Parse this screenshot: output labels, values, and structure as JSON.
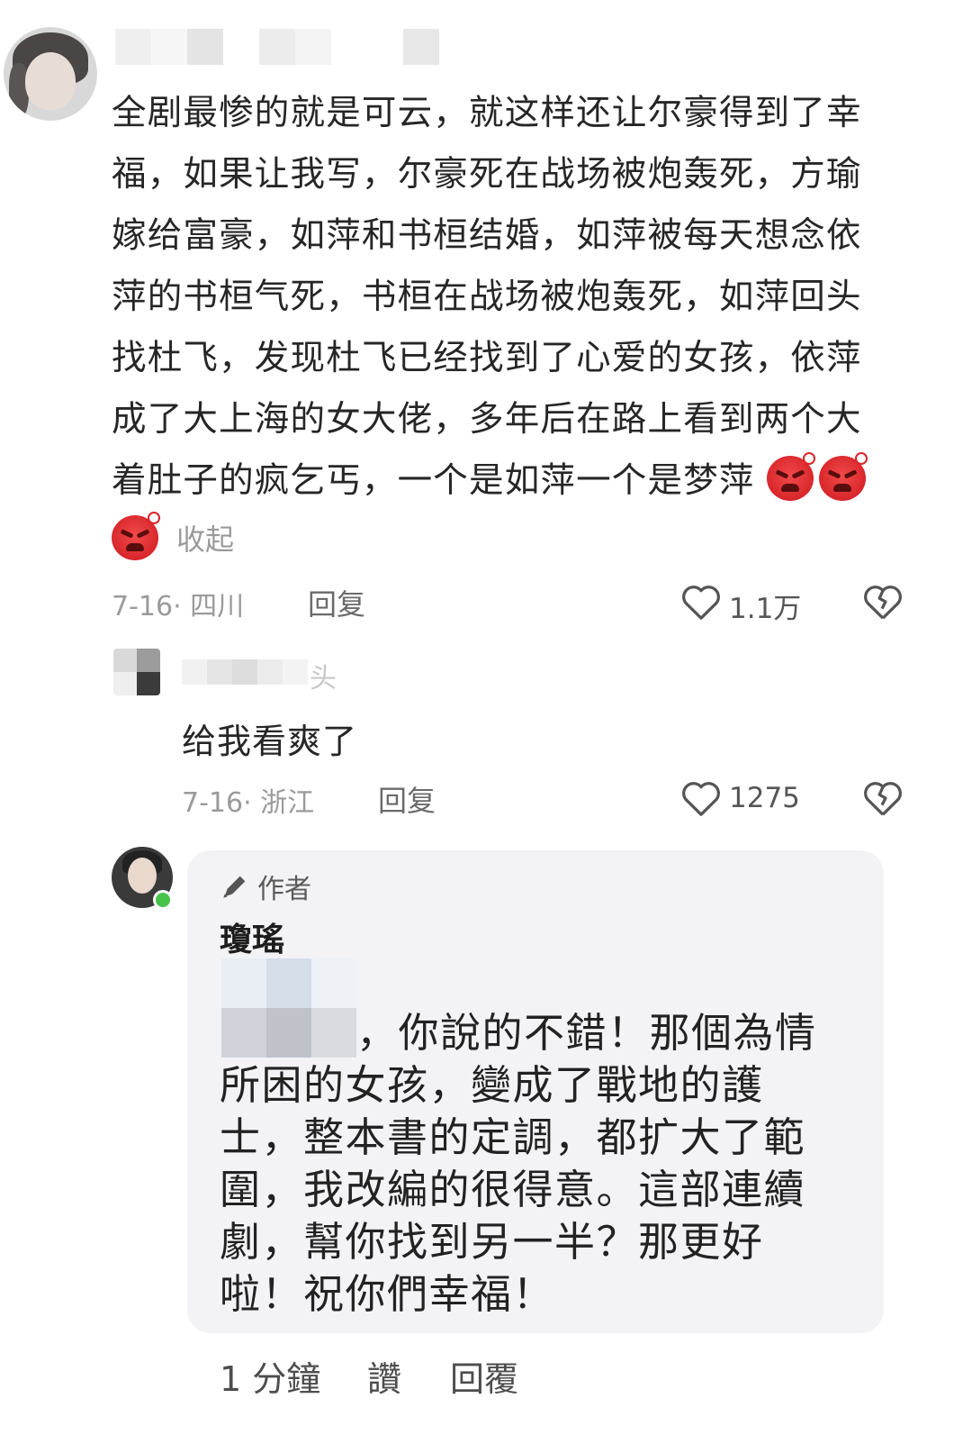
{
  "main_comment": {
    "text_lines": [
      "全剧最惨的就是可云，就这样还让尔豪得到了幸",
      "福，如果让我写，尔豪死在战场被炮轰死，方瑜",
      "嫁给富豪，如萍和书桓结婚，如萍被每天想念依",
      "萍的书桓气死，书桓在战场被炮轰死，如萍回头",
      "找杜飞，发现杜飞已经找到了心爱的女孩，依萍",
      "成了大上海的女大佬，多年后在路上看到两个大",
      "着肚子的疯乞丐，一个是如萍一个是梦萍"
    ],
    "emoji_name": "angry-face-emoji",
    "collapse_label": "收起",
    "date": "7-16",
    "location": "四川",
    "reply_label": "回复",
    "like_count": "1.1万"
  },
  "sub_reply": {
    "username_suffix": "头",
    "text": "给我看爽了",
    "date": "7-16",
    "location": "浙江",
    "reply_label": "回复",
    "like_count": "1275"
  },
  "author_reply": {
    "tag_label": "作者",
    "name": "瓊瑤",
    "text_first_line": "，你說的不錯！那個為情",
    "text_lines": [
      "所困的女孩，變成了戰地的護",
      "士，整本書的定調，都扩大了範",
      "圍，我改編的很得意。這部連續",
      "劇，幫你找到另一半？那更好",
      "啦！祝你們幸福！"
    ],
    "time": "1 分鐘",
    "like_label": "讚",
    "reply_label": "回覆"
  },
  "colors": {
    "accent_red": "#d8262b",
    "meta_gray": "#9a9a9a",
    "card_bg": "#f3f3f5",
    "online_green": "#47c24b"
  }
}
